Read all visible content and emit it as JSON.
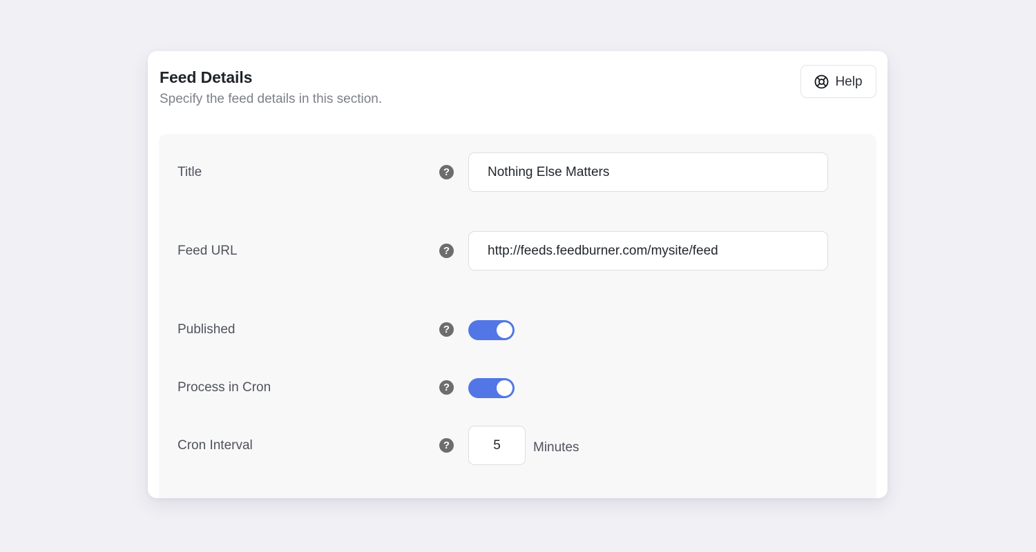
{
  "card": {
    "title": "Feed Details",
    "subtitle": "Specify the feed details in this section.",
    "help_button": {
      "label": "Help",
      "icon": "lifebuoy-icon"
    }
  },
  "colors": {
    "page_background": "#f1f0f5",
    "card_background": "#ffffff",
    "panel_background": "#f8f8f9",
    "toggle_on": "#5276e5",
    "toggle_knob": "#ffffff",
    "help_dot": "#6d6d6d",
    "label_text": "#4f535b",
    "title_text": "#1f2329",
    "subtitle_text": "#7d8089",
    "input_border": "#dededf"
  },
  "fields": {
    "title": {
      "label": "Title",
      "help_icon": "question-mark-icon",
      "value": "Nothing Else Matters",
      "placeholder": ""
    },
    "feed_url": {
      "label": "Feed URL",
      "help_icon": "question-mark-icon",
      "value": "http://feeds.feedburner.com/mysite/feed",
      "placeholder": ""
    },
    "published": {
      "label": "Published",
      "help_icon": "question-mark-icon",
      "state": "on"
    },
    "process_in_cron": {
      "label": "Process in Cron",
      "help_icon": "question-mark-icon",
      "state": "on"
    },
    "cron_interval": {
      "label": "Cron Interval",
      "help_icon": "question-mark-icon",
      "value": "5",
      "unit": "Minutes",
      "placeholder": ""
    }
  },
  "help_glyph": "?"
}
